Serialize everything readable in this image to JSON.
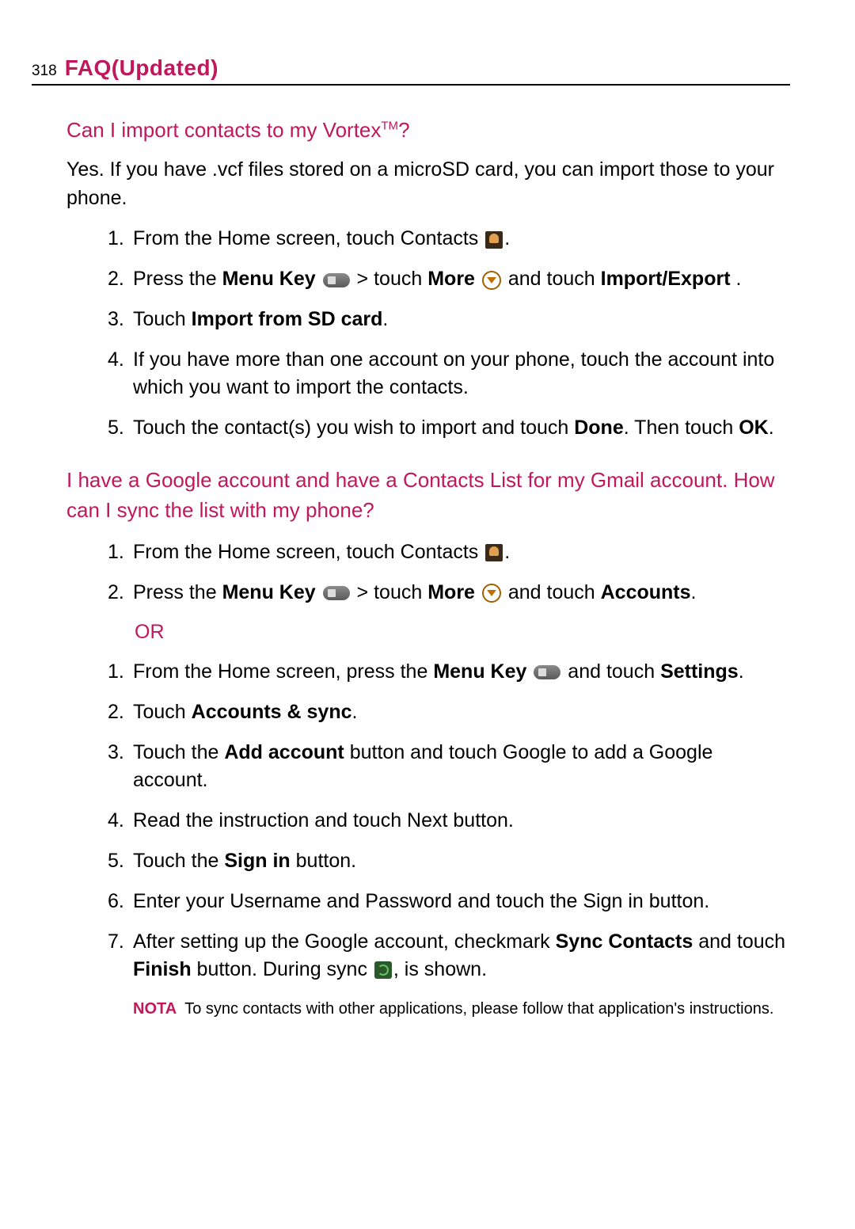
{
  "header": {
    "page_number": "318",
    "title": "FAQ(Updated)"
  },
  "q1": {
    "title_pre": "Can I import contacts to my Vortex",
    "title_tm": "TM",
    "title_post": "?",
    "intro": "Yes. If you have .vcf files stored on a microSD card, you can import those to your phone.",
    "steps": [
      {
        "num": "1.",
        "pre": "From the Home screen, touch Contacts ",
        "post": "."
      },
      {
        "num": "2.",
        "pre": "Press the ",
        "b1": "Menu Key",
        "mid1": "  > touch ",
        "b2": "More",
        "mid2": " and touch ",
        "b3": "Import/Export",
        "post": " ."
      },
      {
        "num": "3.",
        "pre": "Touch ",
        "b1": "Import from SD card",
        "post": "."
      },
      {
        "num": "4.",
        "text": "If you have more than one account on your phone, touch the account into which you want to import the contacts."
      },
      {
        "num": "5.",
        "pre": "Touch the contact(s) you wish to import and touch ",
        "b1": "Done",
        "mid1": ". Then touch ",
        "b2": "OK",
        "post": "."
      }
    ]
  },
  "q2": {
    "title": "I have a Google account and have a Contacts List for my Gmail account. How can I sync the list with my phone?",
    "stepsA": [
      {
        "num": "1.",
        "pre": "From the Home screen, touch Contacts ",
        "post": "."
      },
      {
        "num": "2.",
        "pre": "Press the ",
        "b1": "Menu Key",
        "mid1": "  > touch ",
        "b2": "More",
        "mid2": " and touch ",
        "b3": "Accounts",
        "post": "."
      }
    ],
    "or_label": "OR",
    "stepsB": [
      {
        "num": "1.",
        "pre": "From the Home screen, press the ",
        "b1": "Menu Key",
        "mid1": " and touch ",
        "b2": "Settings",
        "post": "."
      },
      {
        "num": "2.",
        "pre": "Touch ",
        "b1": "Accounts & sync",
        "post": "."
      },
      {
        "num": "3.",
        "pre": "Touch the ",
        "b1": "Add account",
        "post": " button and touch Google to add a Google account."
      },
      {
        "num": "4.",
        "text": "Read the instruction and touch Next button."
      },
      {
        "num": "5.",
        "pre": "Touch the ",
        "b1": "Sign in",
        "post": " button."
      },
      {
        "num": "6.",
        "text": "Enter your Username and Password and touch the Sign in button."
      },
      {
        "num": "7.",
        "pre": "After setting up the Google account, checkmark ",
        "b1": "Sync Contacts",
        "mid1": " and touch ",
        "b2": "Finish",
        "mid2": " button. During sync ",
        "post": ", is shown."
      }
    ],
    "note_label": "NOTA",
    "note_text": "To sync contacts with other applications, please follow that application's instructions."
  }
}
